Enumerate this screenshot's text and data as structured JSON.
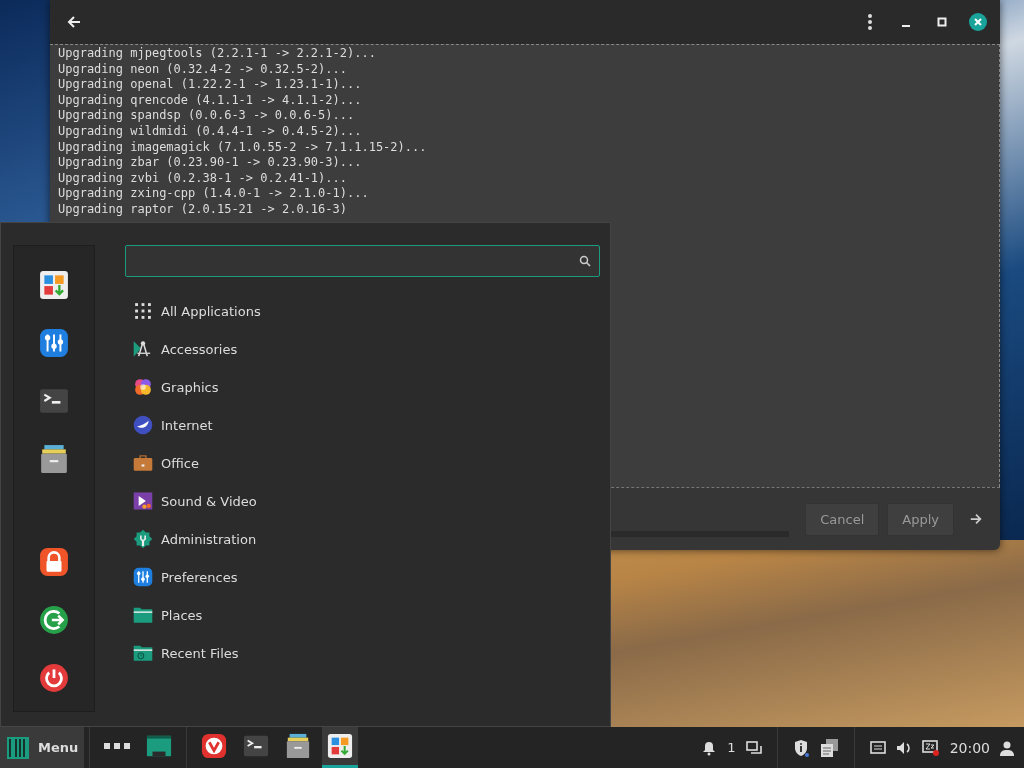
{
  "window": {
    "log_lines": [
      "Upgrading mjpegtools (2.2.1-1 -> 2.2.1-2)...",
      "Upgrading neon (0.32.4-2 -> 0.32.5-2)...",
      "Upgrading openal (1.22.2-1 -> 1.23.1-1)...",
      "Upgrading qrencode (4.1.1-1 -> 4.1.1-2)...",
      "Upgrading spandsp (0.0.6-3 -> 0.0.6-5)...",
      "Upgrading wildmidi (0.4.4-1 -> 0.4.5-2)...",
      "Upgrading imagemagick (7.1.0.55-2 -> 7.1.1.15-2)...",
      "Upgrading zbar (0.23.90-1 -> 0.23.90-3)...",
      "Upgrading zvbi (0.2.38-1 -> 0.2.41-1)...",
      "Upgrading zxing-cpp (1.4.0-1 -> 2.1.0-1)...",
      "Upgrading raptor (2.0.15-21 -> 2.0.16-3)"
    ],
    "buttons": [
      {
        "label": "Cancel"
      },
      {
        "label": "Apply"
      }
    ]
  },
  "menu": {
    "favorites": [
      {
        "kind": "software"
      },
      {
        "kind": "settings"
      },
      {
        "kind": "terminal"
      },
      {
        "kind": "files"
      }
    ],
    "session": [
      {
        "kind": "lock"
      },
      {
        "kind": "logout"
      },
      {
        "kind": "power"
      }
    ],
    "categories": [
      {
        "label": "All Applications",
        "kind": "grid"
      },
      {
        "label": "Accessories",
        "kind": "accessories"
      },
      {
        "label": "Graphics",
        "kind": "graphics"
      },
      {
        "label": "Internet",
        "kind": "internet"
      },
      {
        "label": "Office",
        "kind": "office"
      },
      {
        "label": "Sound & Video",
        "kind": "media"
      },
      {
        "label": "Administration",
        "kind": "admin"
      },
      {
        "label": "Preferences",
        "kind": "settings"
      },
      {
        "label": "Places",
        "kind": "folder"
      },
      {
        "label": "Recent Files",
        "kind": "recent"
      }
    ]
  },
  "taskbar": {
    "menu_label": "Menu",
    "launchers": [
      {
        "kind": "dots"
      },
      {
        "kind": "desktop"
      }
    ],
    "apps": [
      {
        "kind": "browser",
        "selected": false
      },
      {
        "kind": "terminal",
        "selected": false
      },
      {
        "kind": "files",
        "selected": false
      },
      {
        "kind": "software",
        "selected": true
      }
    ],
    "notification_count": "1",
    "clock": "20:00"
  }
}
